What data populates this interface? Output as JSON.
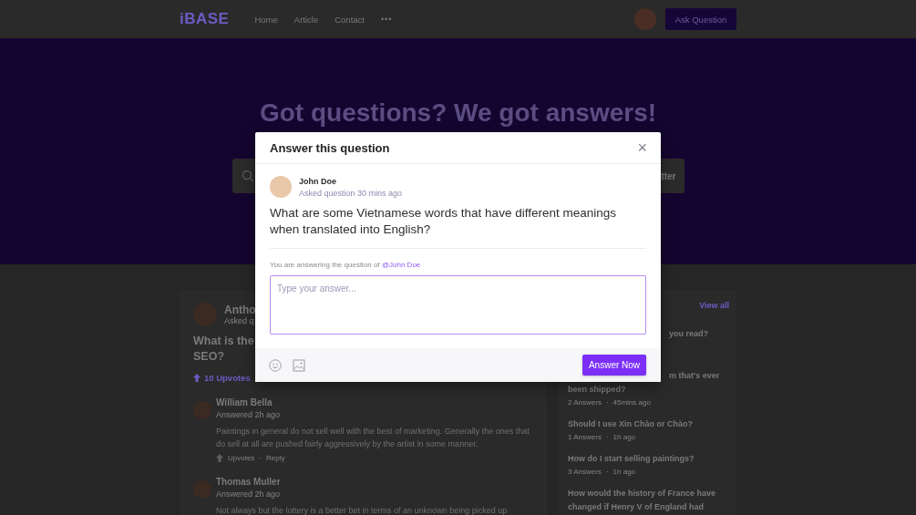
{
  "header": {
    "logo": "iBASE",
    "nav": [
      {
        "label": "Home"
      },
      {
        "label": "Article"
      },
      {
        "label": "Contact"
      }
    ],
    "more": "•••",
    "ask_button": "Ask Question"
  },
  "hero": {
    "title": "Got questions? We got answers!",
    "filter_fragment": "tter"
  },
  "question_card": {
    "author_fragment": "Antho",
    "meta_fragment": "Asked q",
    "title_lines": [
      "What is the",
      "SEO?"
    ],
    "upvotes": "10 Upvotes",
    "answers": [
      {
        "name": "William Bella",
        "meta": "Answered 2h ago",
        "text": "Paintings in general do not sell well with the best of marketing. Generally the ones that do sell at all are pushed fairly aggressively by the artist in some manner.",
        "upvotes": "Upvotes",
        "separator": "·",
        "reply": "Reply"
      },
      {
        "name": "Thomas Muller",
        "meta": "Answered 2h ago",
        "text": "Not always but the lottery is a better bet in terms of an unknown being picked up"
      }
    ]
  },
  "side_card": {
    "view_all": "View all",
    "items": [
      {
        "lines": [
          {
            "text": "you read?",
            "covered": true
          }
        ]
      },
      {
        "lines": [
          {
            "text": "m that's ever",
            "covered": true
          },
          {
            "text": "been shipped?",
            "covered": false
          }
        ],
        "answers": "2 Answers",
        "separator": "·",
        "time": "45mins ago"
      },
      {
        "lines": [
          {
            "text": "Should I use Xin Chào or Chào?",
            "covered": false
          }
        ],
        "answers": "1 Answers",
        "separator": "·",
        "time": "1h ago"
      },
      {
        "lines": [
          {
            "text": "How do I start selling paintings?",
            "covered": false
          }
        ],
        "answers": "3 Answers",
        "separator": "·",
        "time": "1h ago"
      },
      {
        "lines": [
          {
            "text": "How would the history of France have",
            "covered": false
          },
          {
            "text": "changed if Henry V of England had",
            "covered": false
          }
        ]
      }
    ]
  },
  "modal": {
    "title": "Answer this question",
    "close": "×",
    "author": "John Doe",
    "meta": "Asked question 30 mins ago",
    "question": "What are some Vietnamese words that have different meanings when translated into English?",
    "answering_prefix": "You are answering the question of",
    "answering_link": "@John Doe",
    "placeholder": "Type your answer...",
    "submit": "Answer Now"
  }
}
